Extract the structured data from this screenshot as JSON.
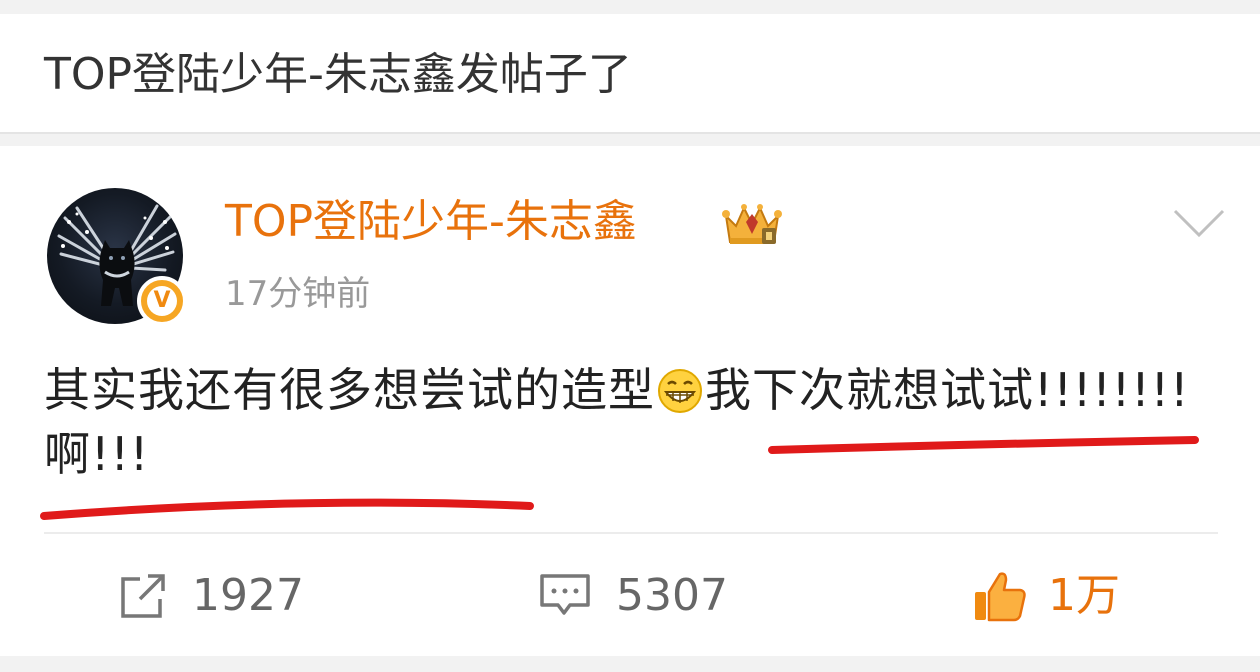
{
  "header": {
    "title": "TOP登陆少年-朱志鑫发帖子了"
  },
  "post": {
    "author": "TOP登陆少年-朱志鑫",
    "timestamp": "17分钟前",
    "text_before_emoji": "其实我还有很多想尝试的造型",
    "emoji": "grin-emoji",
    "text_after_emoji": "我下次就想试试!!!!!!!! 啊!!!",
    "verified_badge_letter": "V",
    "author_color": "#e8720c"
  },
  "actions": {
    "repost_count": "1927",
    "comment_count": "5307",
    "like_count": "1万",
    "like_color": "#e8720c"
  }
}
